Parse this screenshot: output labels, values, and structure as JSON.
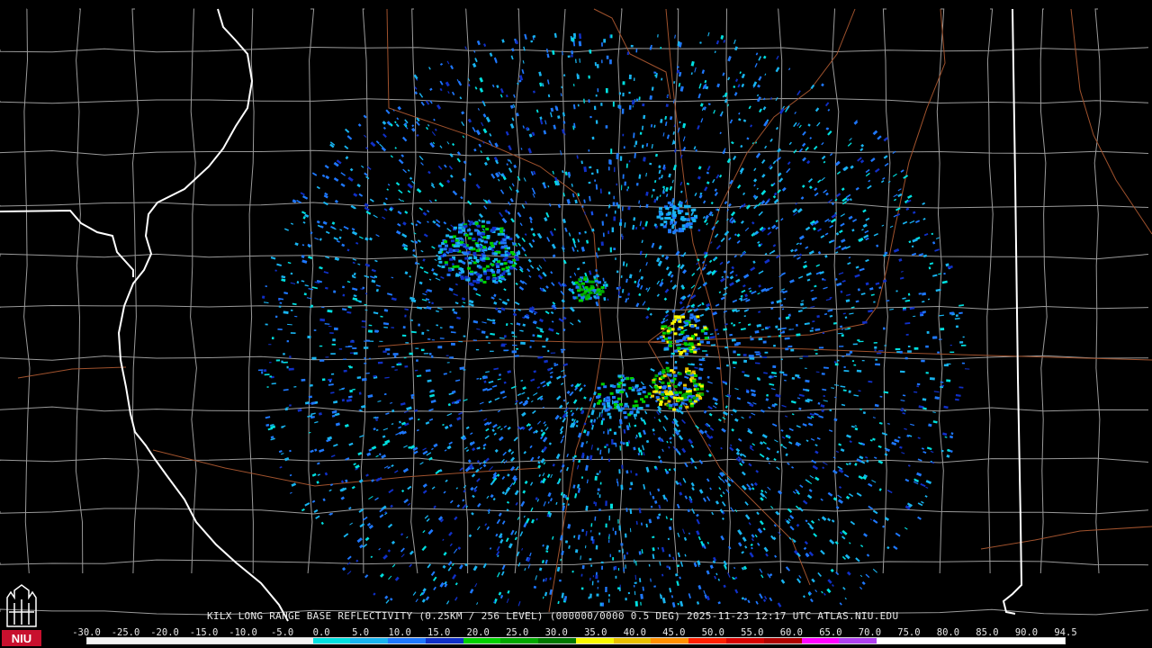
{
  "product": {
    "caption": "KILX LONG RANGE BASE REFLECTIVITY (0.25KM / 256 LEVEL) (000000/0000 0.5 DEG) 2025-11-23 12:17 UTC  ATLAS.NIU.EDU"
  },
  "logo": {
    "text": "NIU",
    "icon": "university-tower-icon",
    "color": "#c8102e"
  },
  "scale": {
    "labels": [
      "-30.0",
      "-25.0",
      "-20.0",
      "-15.0",
      "-10.0",
      "-5.0",
      "0.0",
      "5.0",
      "10.0",
      "15.0",
      "20.0",
      "25.0",
      "30.0",
      "35.0",
      "40.0",
      "45.0",
      "50.0",
      "55.0",
      "60.0",
      "65.0",
      "70.0",
      "75.0",
      "80.0",
      "85.0",
      "90.0",
      "94.5"
    ],
    "colors": [
      "#f2f2f2",
      "#f2f2f2",
      "#f2f2f2",
      "#f2f2f2",
      "#f2f2f2",
      "#f2f2f2",
      "#00e0e0",
      "#18b4f0",
      "#1e78ff",
      "#1030c8",
      "#00d000",
      "#00a800",
      "#007800",
      "#f8f800",
      "#e8c000",
      "#ff9000",
      "#ff2000",
      "#d80000",
      "#b00000",
      "#ff00ff",
      "#b040f0",
      "#ffffff",
      "#ffffff",
      "#ffffff",
      "#ffffff",
      "#ffffff"
    ]
  },
  "map_colors": {
    "state_border": "#ffffff",
    "county_border": "#9a9a9a",
    "highway": "#a0522d"
  }
}
